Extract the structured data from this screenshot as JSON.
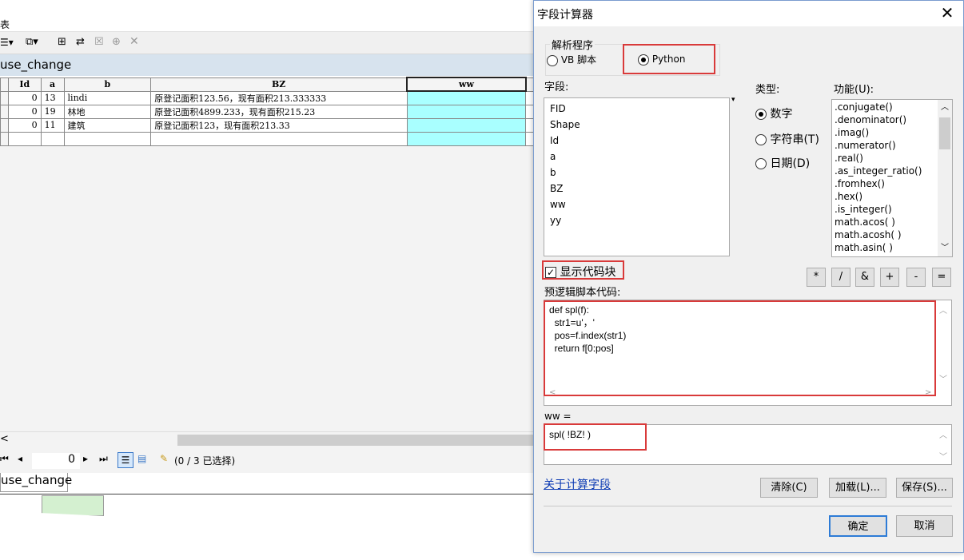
{
  "background": {
    "title_fragment": "表",
    "table_name": "use_change",
    "columns": [
      "Id",
      "a",
      "b",
      "BZ",
      "ww"
    ],
    "rows": [
      {
        "Id": "0",
        "a": "13",
        "b": "lindi",
        "BZ": "原登记面积123.56，现有面积213.333333",
        "ww": ""
      },
      {
        "Id": "0",
        "a": "19",
        "b": "林地",
        "BZ": "原登记面积4899.233，现有面积215.23",
        "ww": ""
      },
      {
        "Id": "0",
        "a": "11",
        "b": "建筑",
        "BZ": "原登记面积123，现有面积213.33",
        "ww": ""
      }
    ],
    "page_number": "0",
    "selection_status": "(0 / 3 已选择)",
    "bottom_tab": "use_change",
    "scroll_left_glyph": "<"
  },
  "dialog": {
    "title": "字段计算器",
    "parser_group_label": "解析程序",
    "parser_vb": "VB 脚本",
    "parser_python": "Python",
    "fields_label": "字段:",
    "fields": [
      "FID",
      "Shape",
      "Id",
      "a",
      "b",
      "BZ",
      "ww",
      "yy"
    ],
    "type_label": "类型:",
    "types": [
      "数字",
      "字符串(T)",
      "日期(D)"
    ],
    "function_label": "功能(U):",
    "functions": [
      ".conjugate()",
      ".denominator()",
      ".imag()",
      ".numerator()",
      ".real()",
      ".as_integer_ratio()",
      ".fromhex()",
      ".hex()",
      ".is_integer()",
      "math.acos( )",
      "math.acosh( )",
      "math.asin( )"
    ],
    "show_codeblock_label": "显示代码块",
    "show_codeblock_checked": true,
    "operators": [
      "*",
      "/",
      "&",
      "+",
      "-",
      "="
    ],
    "prelogic_label": "预逻辑脚本代码:",
    "prelogic_code": "def spl(f):\n  str1=u'，'\n  pos=f.index(str1)\n  return f[0:pos]",
    "expression_label": "ww =",
    "expression": "spl( !BZ! )",
    "about_link": "关于计算字段",
    "clear_button": "清除(C)",
    "load_button": "加载(L)...",
    "save_button": "保存(S)...",
    "ok_button": "确定",
    "cancel_button": "取消",
    "highlight_color": "#d93a3a"
  }
}
